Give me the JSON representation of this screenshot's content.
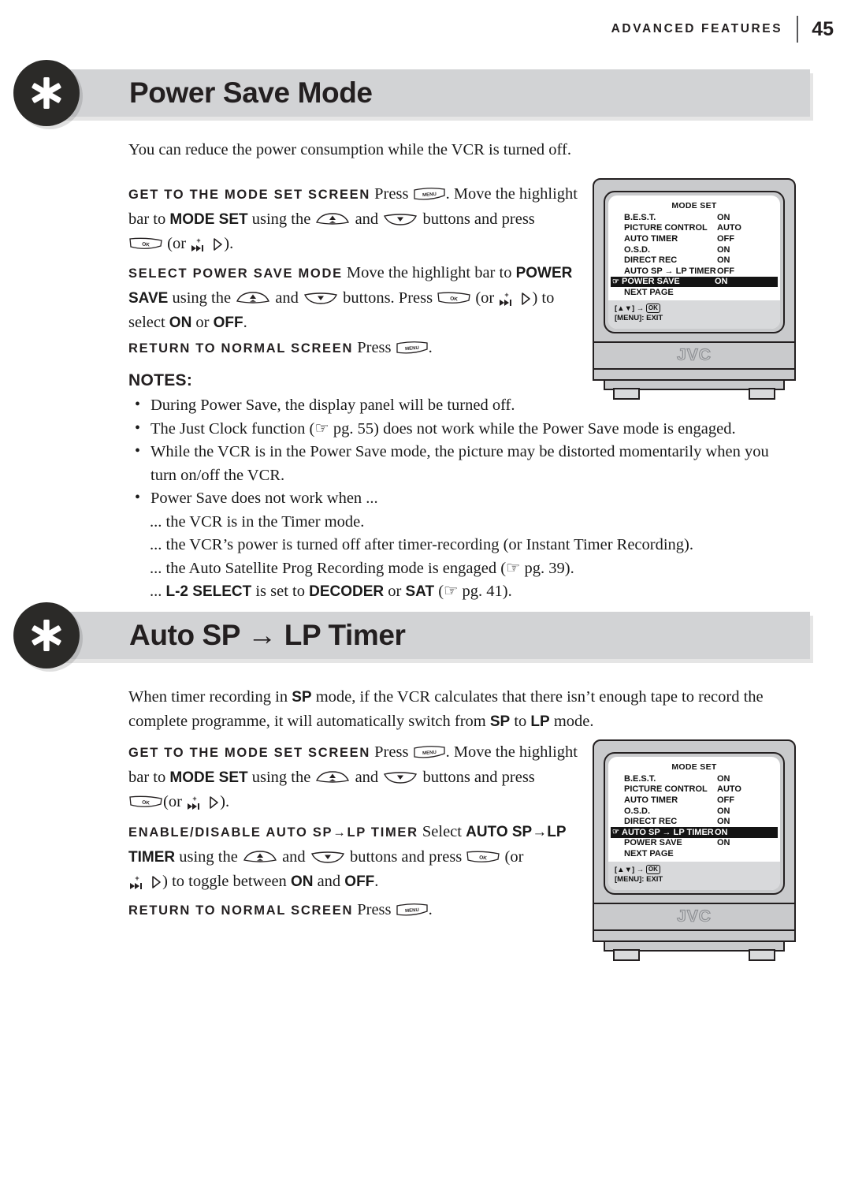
{
  "header": {
    "section": "ADVANCED FEATURES",
    "page_number": "45"
  },
  "sections": [
    {
      "title": "Power Save Mode",
      "icon": "asterisk-star-icon",
      "lead": "You can reduce the power consumption while the VCR is turned off.",
      "steps": [
        {
          "label": "GET TO THE MODE SET SCREEN",
          "text_1": "Press",
          "text_2": ". Move the highlight bar to",
          "bold_1": "MODE SET",
          "text_3": "using the",
          "text_4": "and",
          "text_5": "buttons and press",
          "text_6": "(or",
          "text_7": ")."
        },
        {
          "label": "SELECT POWER SAVE MODE",
          "text_1": "Move the highlight bar to",
          "bold_1": "POWER SAVE",
          "text_2": "using the",
          "text_3": "and",
          "text_4": "buttons. Press",
          "text_5": "(or",
          "text_6": ") to select",
          "bold_2": "ON",
          "text_7": "or",
          "bold_3": "OFF",
          "text_8": "."
        },
        {
          "label": "RETURN TO NORMAL SCREEN",
          "text_1": "Press",
          "text_2": "."
        }
      ],
      "notes_heading": "NOTES:",
      "notes": [
        "During Power Save, the display panel will be turned off.",
        "The Just Clock function (☞ pg. 55) does not work while the Power Save mode is engaged.",
        "While the VCR is in the Power Save mode, the picture may be distorted momentarily when you turn on/off the VCR.",
        "Power Save does not work when ..."
      ],
      "sub_notes": [
        "... the VCR is in the Timer mode.",
        "... the VCR’s power is turned off after timer-recording (or Instant Timer Recording).",
        "... the Auto Satellite Prog Recording mode is engaged (☞ pg. 39).",
        "... L-2 SELECT is set to DECODER or SAT (☞ pg. 41)."
      ],
      "sub_note_4_parts": {
        "prefix": "...",
        "bold_1": "L-2 SELECT",
        "mid_1": "is set to",
        "bold_2": "DECODER",
        "mid_2": "or",
        "bold_3": "SAT",
        "suffix": "(☞ pg. 41)."
      }
    },
    {
      "title": "Auto SP → LP Timer",
      "icon": "asterisk-star-icon",
      "lead_parts": {
        "t1": "When timer recording in",
        "b1": "SP",
        "t2": "mode, if the VCR calculates that there isn’t enough tape to record the complete programme, it will automatically switch from",
        "b2": "SP",
        "t3": "to",
        "b3": "LP",
        "t4": "mode."
      },
      "steps": [
        {
          "label": "GET TO THE MODE SET SCREEN"
        },
        {
          "label": "ENABLE/DISABLE AUTO SP→LP TIMER",
          "text_1": "Select",
          "bold_1": "AUTO SP→LP TIMER",
          "text_2": "using the",
          "text_3": "and",
          "text_4": "buttons and press",
          "text_5": "(or",
          "text_6": ") to toggle between",
          "bold_2": "ON",
          "text_7": "and",
          "bold_3": "OFF",
          "text_8": "."
        },
        {
          "label": "RETURN TO NORMAL SCREEN"
        }
      ]
    }
  ],
  "remote_buttons": {
    "menu": "MENU",
    "ok": "OK",
    "up": "up-arrow-button",
    "down": "down-arrow-button",
    "skip": "skip-forward-button",
    "right": "right-arrow-button"
  },
  "tv_screens": [
    {
      "brand": "JVC",
      "osd_title": "MODE SET",
      "rows": [
        {
          "label": "B.E.S.T.",
          "value": "ON",
          "selected": false
        },
        {
          "label": "PICTURE CONTROL",
          "value": "AUTO",
          "selected": false
        },
        {
          "label": "AUTO TIMER",
          "value": "OFF",
          "selected": false
        },
        {
          "label": "O.S.D.",
          "value": "ON",
          "selected": false
        },
        {
          "label": "DIRECT REC",
          "value": "ON",
          "selected": false
        },
        {
          "label": "AUTO SP → LP TIMER",
          "value": "OFF",
          "selected": false
        },
        {
          "label": "POWER SAVE",
          "value": "ON",
          "selected": true
        },
        {
          "label": "NEXT PAGE",
          "value": "",
          "selected": false
        }
      ],
      "footer_line_1_prefix": "[▲▼] →",
      "footer_line_1_ok": "OK",
      "footer_line_2": "[MENU]: EXIT"
    },
    {
      "brand": "JVC",
      "osd_title": "MODE SET",
      "rows": [
        {
          "label": "B.E.S.T.",
          "value": "ON",
          "selected": false
        },
        {
          "label": "PICTURE CONTROL",
          "value": "AUTO",
          "selected": false
        },
        {
          "label": "AUTO TIMER",
          "value": "OFF",
          "selected": false
        },
        {
          "label": "O.S.D.",
          "value": "ON",
          "selected": false
        },
        {
          "label": "DIRECT REC",
          "value": "ON",
          "selected": false
        },
        {
          "label": "AUTO SP → LP TIMER",
          "value": "ON",
          "selected": true
        },
        {
          "label": "POWER SAVE",
          "value": "ON",
          "selected": false
        },
        {
          "label": "NEXT PAGE",
          "value": "",
          "selected": false
        }
      ],
      "footer_line_1_prefix": "[▲▼] →",
      "footer_line_1_ok": "OK",
      "footer_line_2": "[MENU]: EXIT"
    }
  ],
  "colors": {
    "banner_gray": "#d2d3d5",
    "star_circle": "#2b2a28",
    "tv_case": "#c9cacc",
    "osd_highlight": "#141414",
    "ink": "#231f20"
  }
}
